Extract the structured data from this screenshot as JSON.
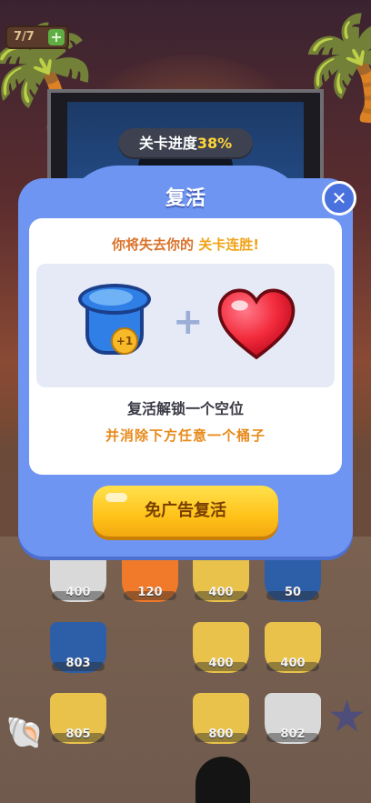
{
  "top": {
    "moves": "7/7",
    "plus": "+",
    "progress_label": "关卡进度",
    "progress_value": "38%"
  },
  "dialog": {
    "title": "复活",
    "close": "✕",
    "warning_prefix": "你将失去你的",
    "warning_highlight": "关卡连胜!",
    "plus_sign": "+",
    "badge": "+1",
    "line1": "复活解锁一个空位",
    "line2": "并消除下方任意一个桶子",
    "revive_button": "免广告复活"
  },
  "board": {
    "buckets": [
      {
        "value": "400",
        "color": "#d9d9d9"
      },
      {
        "value": "120",
        "color": "#f07a2a"
      },
      {
        "value": "400",
        "color": "#e8c24a"
      },
      {
        "value": "50",
        "color": "#2d5ea8"
      },
      {
        "value": "803",
        "color": "#2d5ea8"
      },
      {
        "value": "400",
        "color": "#e8c24a"
      },
      {
        "value": "400",
        "color": "#e8c24a"
      },
      {
        "value": "805",
        "color": "#e8c24a"
      },
      {
        "value": "800",
        "color": "#e8c24a"
      },
      {
        "value": "802",
        "color": "#d9d9d9"
      }
    ]
  },
  "colors": {
    "dialog": "#6e95f2",
    "button": "#ffc21a",
    "accent_orange": "#e88a1a"
  }
}
